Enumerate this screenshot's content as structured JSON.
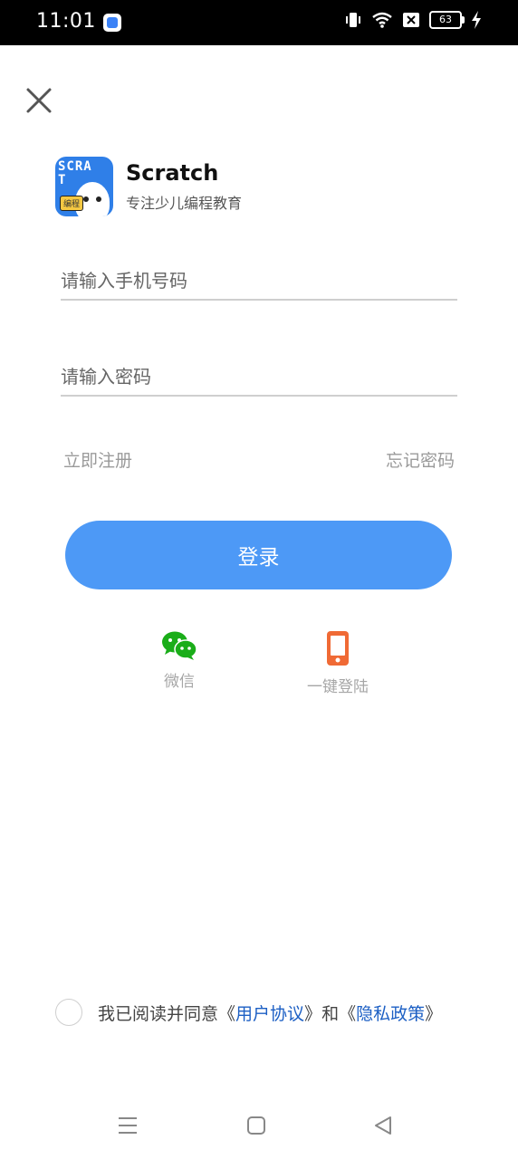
{
  "status_bar": {
    "time": "11:01",
    "battery": "63",
    "icons": [
      "app-notification-icon",
      "vibrate-icon",
      "wifi-icon",
      "sim-off-icon",
      "battery-icon",
      "charging-icon"
    ]
  },
  "brand": {
    "logo_text": "SCRA\nT",
    "logo_tag": "编程",
    "name": "Scratch",
    "slogan": "专注少儿编程教育"
  },
  "form": {
    "phone_placeholder": "请输入手机号码",
    "password_placeholder": "请输入密码",
    "register_label": "立即注册",
    "forgot_label": "忘记密码",
    "login_label": "登录"
  },
  "alt_login": {
    "wechat_label": "微信",
    "onekey_label": "一键登陆"
  },
  "agreement": {
    "prefix": "我已阅读并同意",
    "open1": "《",
    "user_agreement": "用户协议",
    "close1": "》",
    "and": "和",
    "open2": "《",
    "privacy_policy": "隐私政策",
    "close2": "》"
  },
  "colors": {
    "accent": "#4d99f6",
    "link": "#1c5fc4",
    "wechat": "#1aad19",
    "phone_icon": "#f06a35"
  }
}
